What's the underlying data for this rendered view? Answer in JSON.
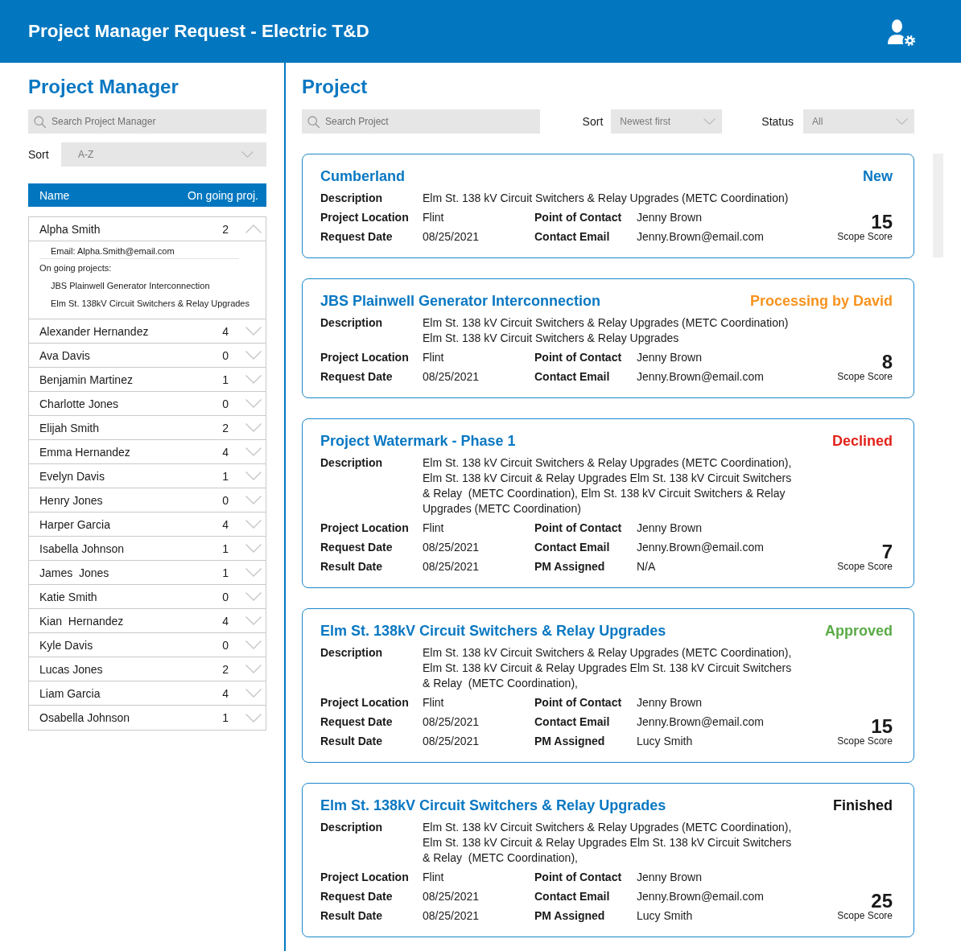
{
  "header": {
    "title": "Project Manager Request - Electric T&D"
  },
  "manager_panel": {
    "title": "Project Manager",
    "search": {
      "placeholder": "Search Project Manager"
    },
    "sort": {
      "label": "Sort",
      "value": "A-Z"
    },
    "table": {
      "columns": [
        "Name",
        "On going proj."
      ],
      "rows": [
        {
          "name": "Alpha Smith",
          "count": "2",
          "expanded": true,
          "email": "Email: Alpha.Smith@email.com",
          "projects_heading": "On going projects:",
          "projects": [
            "JBS Plainwell Generator Interconnection",
            "Elm St. 138kV Circuit Switchers & Relay Upgrades"
          ]
        },
        {
          "name": "Alexander Hernandez",
          "count": "4",
          "expanded": false
        },
        {
          "name": "Ava Davis",
          "count": "0",
          "expanded": false
        },
        {
          "name": "Benjamin Martinez",
          "count": "1",
          "expanded": false
        },
        {
          "name": "Charlotte Jones",
          "count": "0",
          "expanded": false
        },
        {
          "name": "Elijah Smith",
          "count": "2",
          "expanded": false
        },
        {
          "name": "Emma Hernandez",
          "count": "4",
          "expanded": false
        },
        {
          "name": "Evelyn Davis",
          "count": "1",
          "expanded": false
        },
        {
          "name": "Henry Jones",
          "count": "0",
          "expanded": false
        },
        {
          "name": "Harper Garcia",
          "count": "4",
          "expanded": false
        },
        {
          "name": "Isabella Johnson",
          "count": "1",
          "expanded": false
        },
        {
          "name": "James  Jones",
          "count": "1",
          "expanded": false
        },
        {
          "name": "Katie Smith",
          "count": "0",
          "expanded": false
        },
        {
          "name": "Kian  Hernandez",
          "count": "4",
          "expanded": false
        },
        {
          "name": "Kyle Davis",
          "count": "0",
          "expanded": false
        },
        {
          "name": "Lucas Jones",
          "count": "2",
          "expanded": false
        },
        {
          "name": "Liam Garcia",
          "count": "4",
          "expanded": false
        },
        {
          "name": "Osabella Johnson",
          "count": "1",
          "expanded": false
        }
      ]
    }
  },
  "project_panel": {
    "title": "Project",
    "search": {
      "placeholder": "Search Project"
    },
    "sort": {
      "label": "Sort",
      "value": "Newest first"
    },
    "status_filter": {
      "label": "Status",
      "value": "All"
    },
    "cards": [
      {
        "title": "Cumberland",
        "status": {
          "label": "New",
          "color": "#0a78c2"
        },
        "description": {
          "label": "Description",
          "value": "Elm St. 138 kV Circuit Switchers & Relay Upgrades (METC Coordination)"
        },
        "fields": [
          {
            "label": "Project Location",
            "value": "Flint"
          },
          {
            "label": "Point of Contact",
            "value": "Jenny Brown"
          },
          {
            "label": "Request Date",
            "value": "08/25/2021"
          },
          {
            "label": "Contact Email",
            "value": "Jenny.Brown@email.com"
          }
        ],
        "score": {
          "value": "15",
          "label": "Scope Score"
        }
      },
      {
        "title": "JBS Plainwell Generator Interconnection",
        "status": {
          "label": "Processing by David",
          "color": "#f7931e"
        },
        "description": {
          "label": "Description",
          "value": "Elm St. 138 kV Circuit Switchers & Relay Upgrades (METC Coordination) Elm St. 138 kV Circuit Switchers & Relay Upgrades"
        },
        "fields": [
          {
            "label": "Project Location",
            "value": "Flint"
          },
          {
            "label": "Point of Contact",
            "value": "Jenny Brown"
          },
          {
            "label": "Request Date",
            "value": "08/25/2021"
          },
          {
            "label": "Contact Email",
            "value": "Jenny.Brown@email.com"
          }
        ],
        "score": {
          "value": "8",
          "label": "Scope Score"
        }
      },
      {
        "title": "Project Watermark - Phase 1",
        "status": {
          "label": "Declined",
          "color": "#e2231a"
        },
        "description": {
          "label": "Description",
          "value": "Elm St. 138 kV Circuit Switchers & Relay Upgrades (METC Coordination), Elm St. 138 kV Circuit & Relay Upgrades Elm St. 138 kV Circuit Switchers & Relay  (METC Coordination), Elm St. 138 kV Circuit Switchers & Relay Upgrades (METC Coordination)"
        },
        "fields": [
          {
            "label": "Project Location",
            "value": "Flint"
          },
          {
            "label": "Point of Contact",
            "value": "Jenny Brown"
          },
          {
            "label": "Request Date",
            "value": "08/25/2021"
          },
          {
            "label": "Contact Email",
            "value": "Jenny.Brown@email.com"
          },
          {
            "label": "Result Date",
            "value": "08/25/2021"
          },
          {
            "label": "PM Assigned",
            "value": "N/A"
          }
        ],
        "score": {
          "value": "7",
          "label": "Scope Score"
        }
      },
      {
        "title": "Elm St. 138kV Circuit Switchers & Relay Upgrades",
        "status": {
          "label": "Approved",
          "color": "#5aab47"
        },
        "description": {
          "label": "Description",
          "value": "Elm St. 138 kV Circuit Switchers & Relay Upgrades (METC Coordination), Elm St. 138 kV Circuit & Relay Upgrades Elm St. 138 kV Circuit Switchers & Relay  (METC Coordination),"
        },
        "fields": [
          {
            "label": "Project Location",
            "value": "Flint"
          },
          {
            "label": "Point of Contact",
            "value": "Jenny Brown"
          },
          {
            "label": "Request Date",
            "value": "08/25/2021"
          },
          {
            "label": "Contact Email",
            "value": "Jenny.Brown@email.com"
          },
          {
            "label": "Result Date",
            "value": "08/25/2021"
          },
          {
            "label": "PM Assigned",
            "value": "Lucy Smith"
          }
        ],
        "score": {
          "value": "15",
          "label": "Scope Score"
        }
      },
      {
        "title": "Elm St. 138kV Circuit Switchers & Relay Upgrades",
        "status": {
          "label": "Finished",
          "color": "#111111"
        },
        "description": {
          "label": "Description",
          "value": "Elm St. 138 kV Circuit Switchers & Relay Upgrades (METC Coordination), Elm St. 138 kV Circuit & Relay Upgrades Elm St. 138 kV Circuit Switchers & Relay  (METC Coordination),"
        },
        "fields": [
          {
            "label": "Project Location",
            "value": "Flint"
          },
          {
            "label": "Point of Contact",
            "value": "Jenny Brown"
          },
          {
            "label": "Request Date",
            "value": "08/25/2021"
          },
          {
            "label": "Contact Email",
            "value": "Jenny.Brown@email.com"
          },
          {
            "label": "Result Date",
            "value": "08/25/2021"
          },
          {
            "label": "PM Assigned",
            "value": "Lucy Smith"
          }
        ],
        "score": {
          "value": "25",
          "label": "Scope Score"
        }
      }
    ]
  }
}
